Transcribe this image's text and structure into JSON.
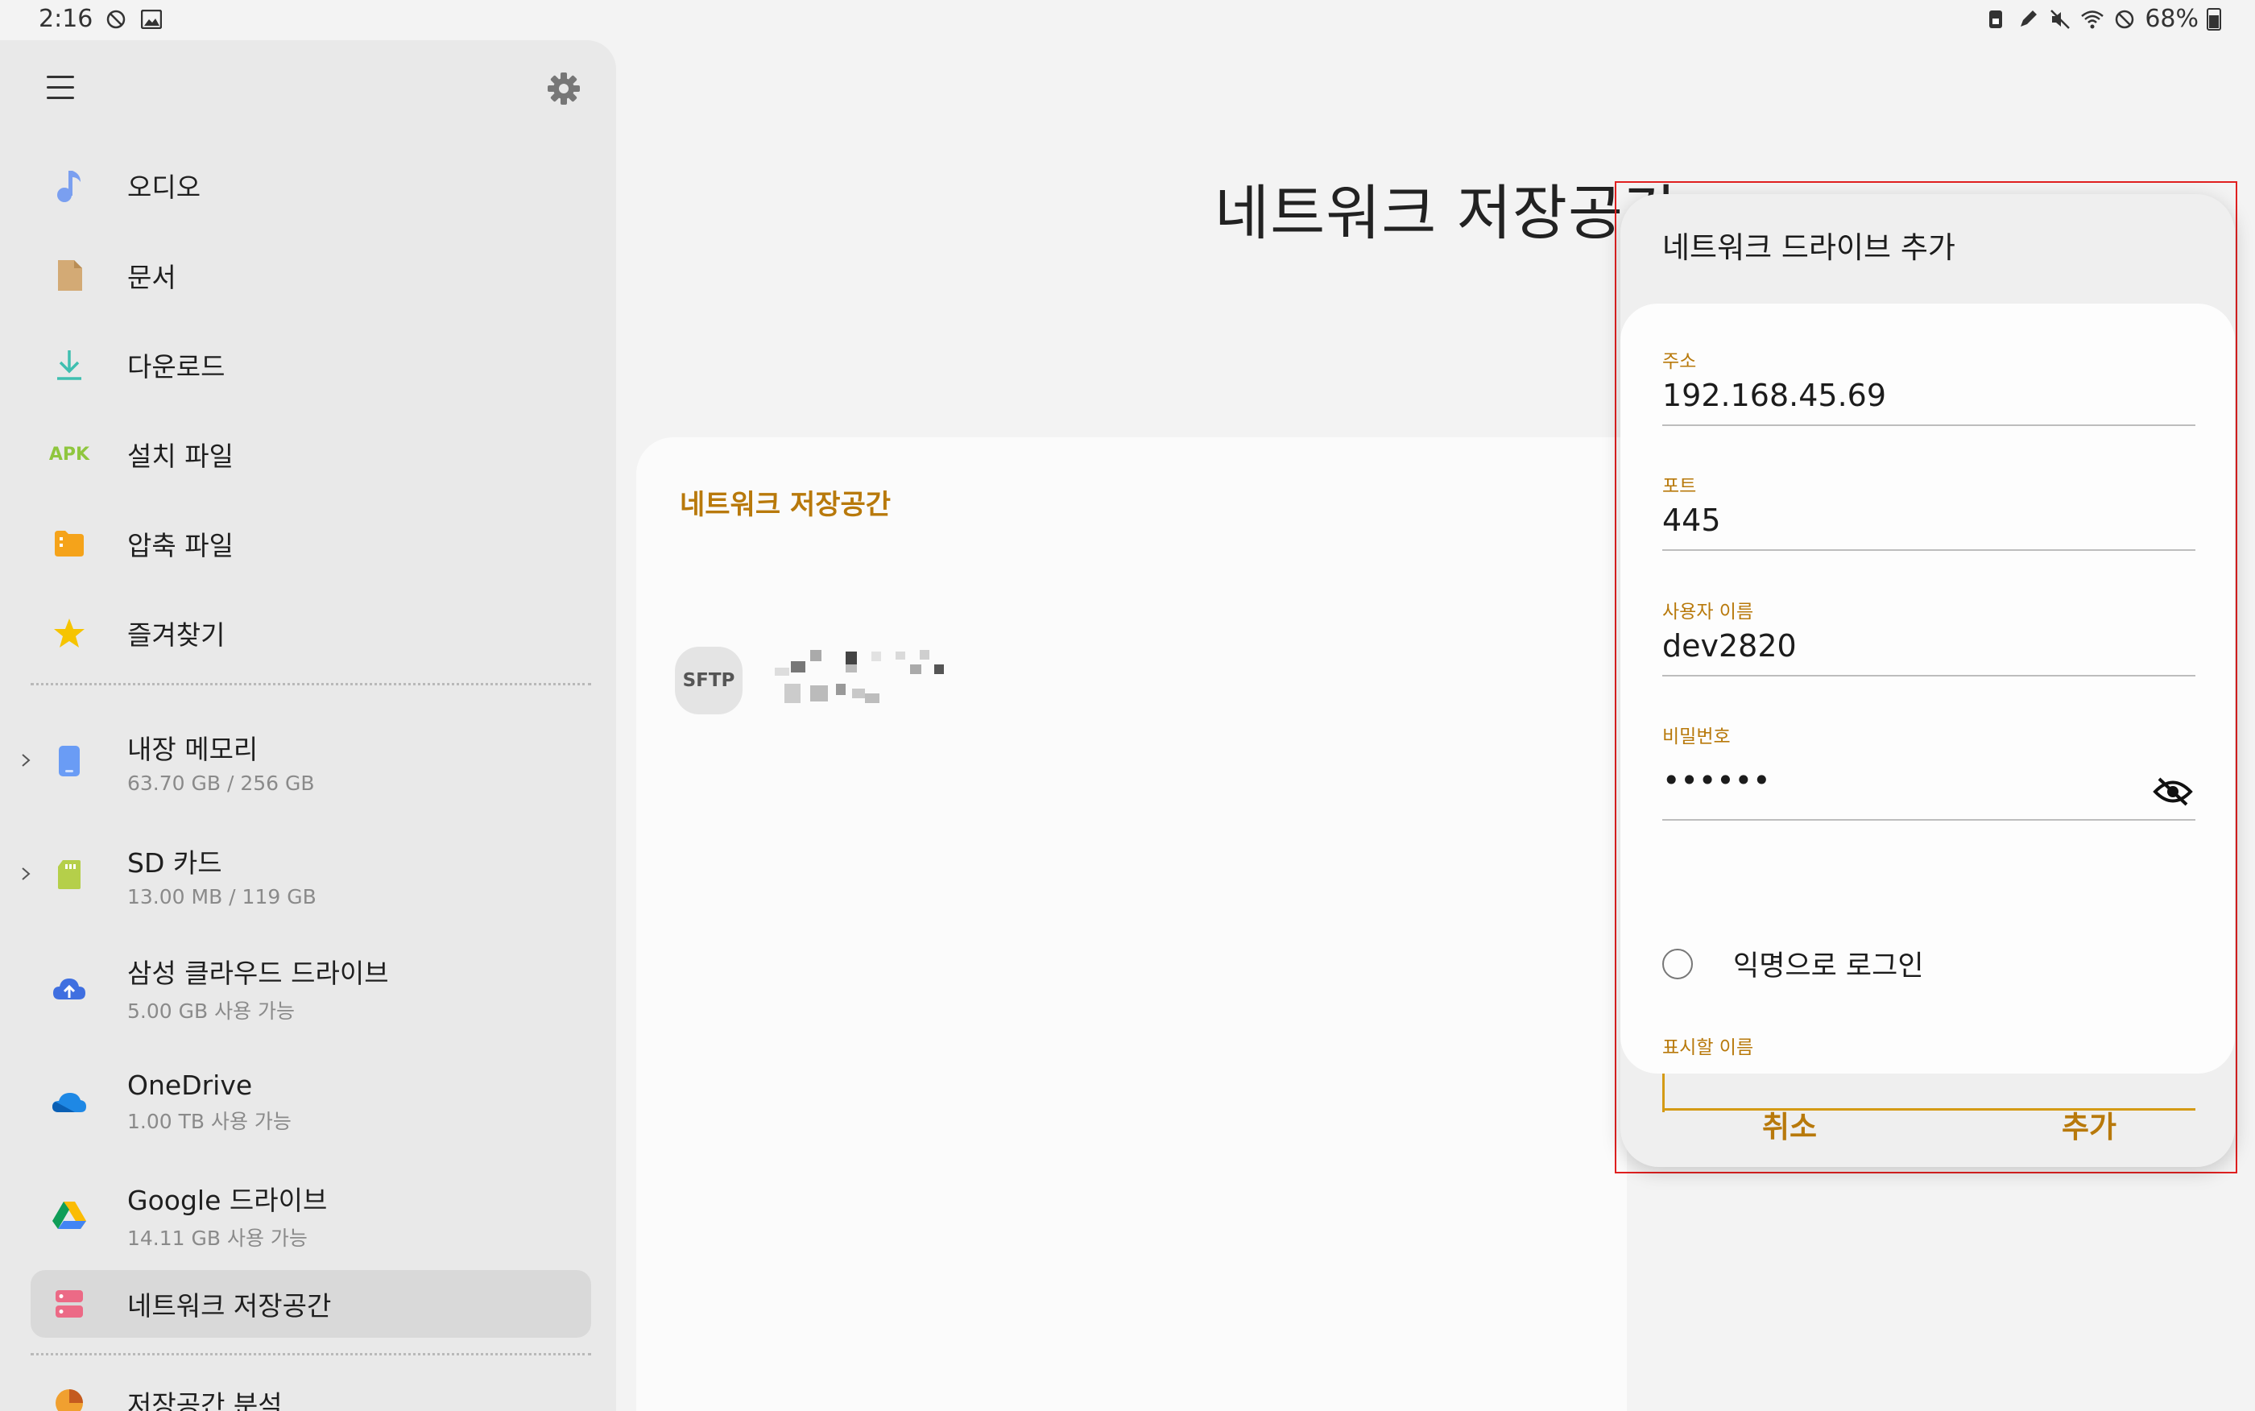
{
  "status_bar": {
    "time": "2:16",
    "battery": "68%"
  },
  "sidebar": {
    "items": [
      {
        "label": "오디오",
        "icon": "music-note-icon"
      },
      {
        "label": "문서",
        "icon": "document-icon"
      },
      {
        "label": "다운로드",
        "icon": "download-icon"
      },
      {
        "label": "설치 파일",
        "icon": "apk-icon",
        "icon_text": "APK"
      },
      {
        "label": "압축 파일",
        "icon": "archive-icon"
      },
      {
        "label": "즐겨찾기",
        "icon": "star-icon"
      }
    ],
    "storage": [
      {
        "label": "내장 메모리",
        "sub": "63.70 GB / 256 GB",
        "icon": "phone-icon"
      },
      {
        "label": "SD 카드",
        "sub": "13.00 MB / 119 GB",
        "icon": "sd-card-icon"
      },
      {
        "label": "삼성 클라우드 드라이브",
        "sub": "5.00 GB 사용 가능",
        "icon": "samsung-cloud-icon"
      },
      {
        "label": "OneDrive",
        "sub": "1.00 TB 사용 가능",
        "icon": "onedrive-icon"
      },
      {
        "label": "Google 드라이브",
        "sub": "14.11 GB 사용 가능",
        "icon": "google-drive-icon"
      }
    ],
    "network": {
      "label": "네트워크 저장공간",
      "icon": "network-storage-icon"
    },
    "analysis": {
      "label": "저장공간 분석",
      "icon": "storage-analysis-icon"
    }
  },
  "main": {
    "title": "네트워크 저장공간",
    "card_title": "네트워크 저장공간",
    "server_badge": "SFTP"
  },
  "dialog": {
    "title": "네트워크 드라이브 추가",
    "address_label": "주소",
    "address_value": "192.168.45.69",
    "port_label": "포트",
    "port_value": "445",
    "username_label": "사용자 이름",
    "username_value": "dev2820",
    "password_label": "비밀번호",
    "password_value": "••••••",
    "anonymous_label": "익명으로 로그인",
    "display_name_label": "표시할 이름",
    "display_name_value": "",
    "cancel_label": "취소",
    "add_label": "추가"
  },
  "colors": {
    "accent": "#b8790b",
    "focus_line": "#d49a14",
    "highlight_frame": "#e02020"
  }
}
